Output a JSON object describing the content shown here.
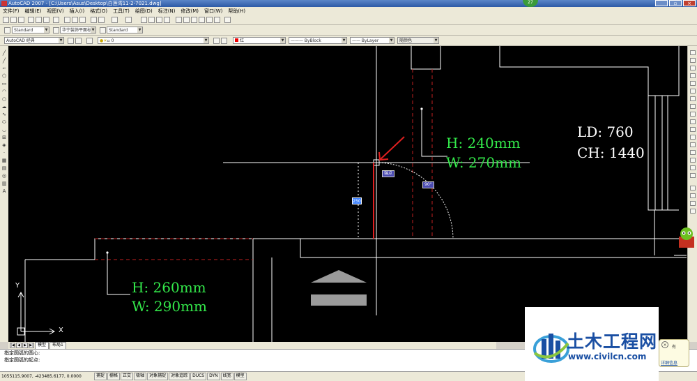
{
  "title_bar": {
    "title": "AutoCAD 2007 - [C:\\Users\\Asus\\Desktop\\白莲湾11-2-7021.dwg]",
    "notification_count": "27"
  },
  "menu": [
    "文件(F)",
    "编辑(E)",
    "视图(V)",
    "插入(I)",
    "格式(O)",
    "工具(T)",
    "绘图(D)",
    "标注(N)",
    "修改(M)",
    "窗口(W)",
    "帮助(H)"
  ],
  "styles_toolbar": {
    "text_style": "Standard",
    "dim_style": "华宁装饰平面标",
    "table_style": "Standard"
  },
  "layers_toolbar": {
    "workspace": "AutoCAD 经典",
    "layer": "0",
    "color": "红",
    "linetype": "ByBlock",
    "lineweight": "ByLayer",
    "plotstyle": "随颜色"
  },
  "drawing": {
    "annotation_left": {
      "h": "H: 260mm",
      "w": "W: 290mm"
    },
    "annotation_right": {
      "h": "H: 240mm",
      "w": "W: 270mm"
    },
    "annotation_ld_ch": {
      "ld": "LD: 760",
      "ch": "CH: 1440"
    },
    "snap_tooltip": "端点",
    "angle_tooltip": "90°",
    "dynamic_input_value": "250",
    "ucs_x": "X",
    "ucs_y": "Y"
  },
  "layout_tabs": {
    "tabs": [
      "模型",
      "布局1"
    ],
    "active": "模型"
  },
  "command_lines": [
    "指定圆弧的圆心:",
    "指定圆弧的起点:"
  ],
  "status_bar": {
    "coords": "1055115.9007, -423485.6177, 0.0000",
    "buttons": [
      "捕捉",
      "栅格",
      "正交",
      "极轴",
      "对象捕捉",
      "对象追踪",
      "DUCS",
      "DYN",
      "线宽",
      "模型"
    ]
  },
  "watermark": {
    "name": "土木工程网",
    "url": "www.civilcn.com"
  },
  "notification_balloon": {
    "title": "有",
    "link": "详细信息"
  },
  "colors": {
    "canvas": "#000000",
    "annotation_green": "#33e84a",
    "dashed_red": "#c02020",
    "arrow_red": "#e02020",
    "logo_blue": "#1a4fa3"
  }
}
